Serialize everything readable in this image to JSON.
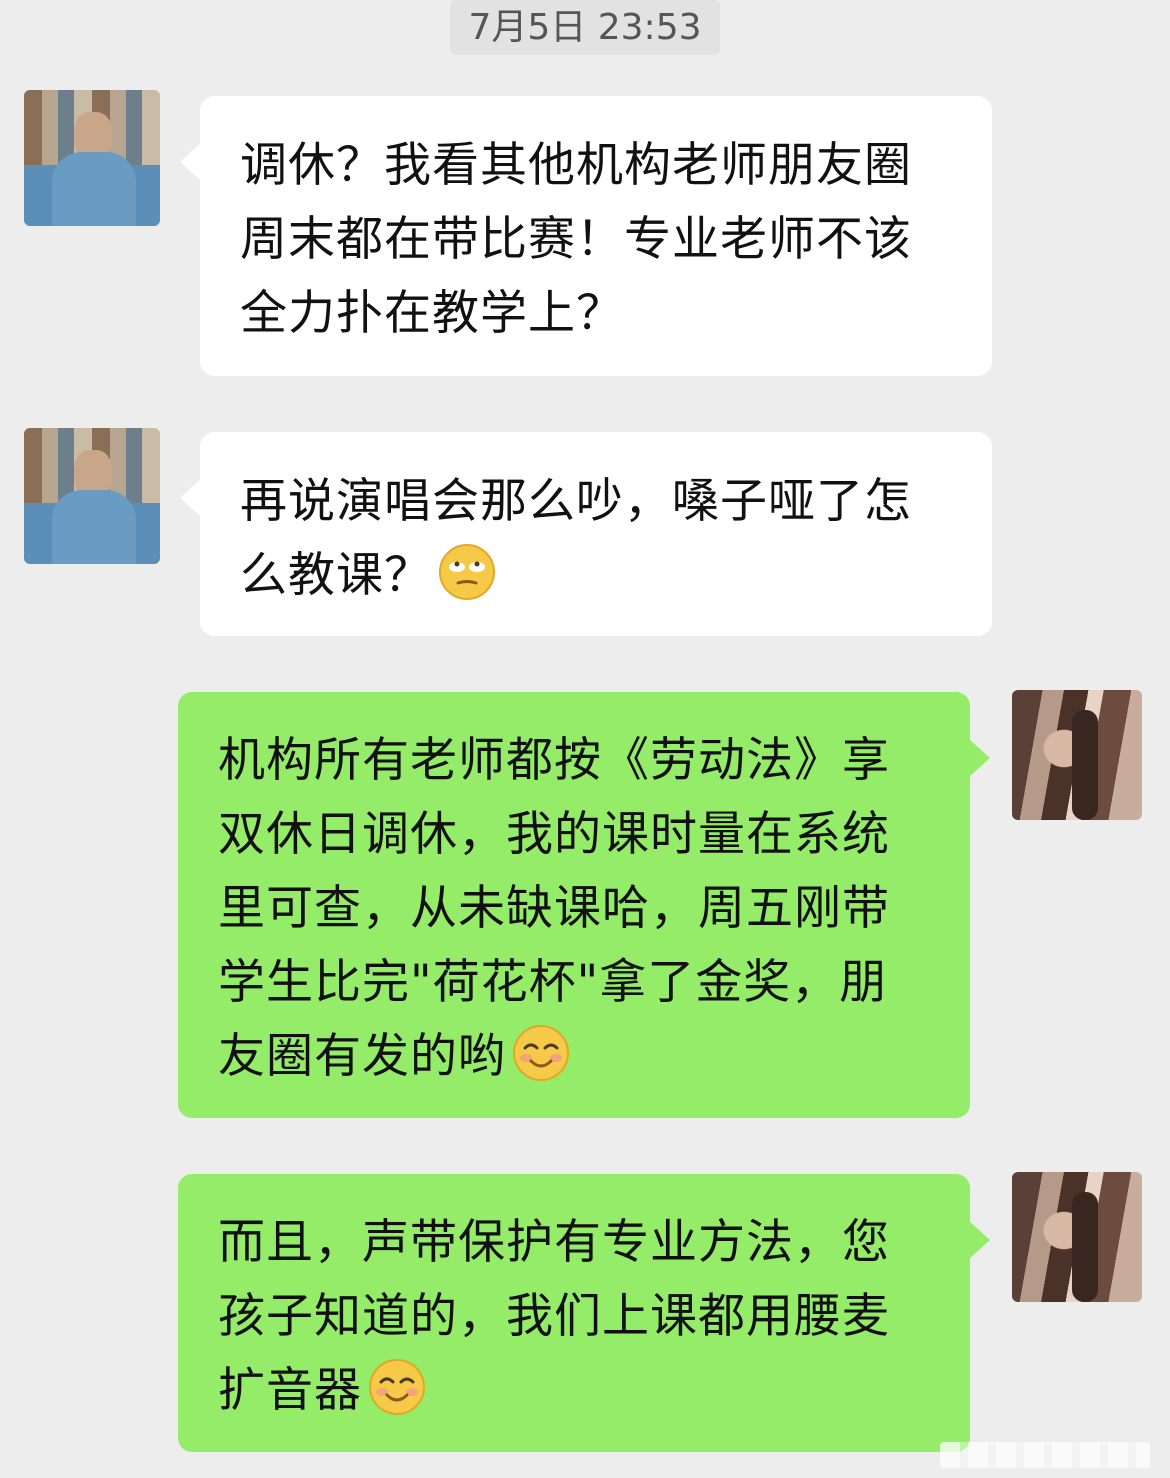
{
  "timestamp": "7月5日 23:53",
  "colors": {
    "background": "#ededed",
    "incoming_bubble": "#ffffff",
    "outgoing_bubble": "#95ec69"
  },
  "messages": [
    {
      "sender": "other",
      "avatar_icon": "pixelated-avatar",
      "lines": [
        "调休？我看其他机构老师朋友圈",
        "周末都在带比赛！专业老师不该",
        "全力扑在教学上？"
      ],
      "trailing_emoji": null
    },
    {
      "sender": "other",
      "avatar_icon": "pixelated-avatar",
      "lines": [
        "再说演唱会那么吵，嗓子哑了怎",
        "么教课？"
      ],
      "trailing_emoji": "eye-roll-emoji"
    },
    {
      "sender": "self",
      "avatar_icon": "profile-photo-avatar",
      "lines": [
        "机构所有老师都按《劳动法》享",
        "双休日调休，我的课时量在系统",
        "里可查，从未缺课哈，周五刚带",
        "学生比完\"荷花杯\"拿了金奖，朋",
        "友圈有发的哟"
      ],
      "trailing_emoji": "smile-emoji"
    },
    {
      "sender": "self",
      "avatar_icon": "profile-photo-avatar",
      "lines": [
        "而且，声带保护有专业方法，您",
        "孩子知道的，我们上课都用腰麦",
        "扩音器"
      ],
      "trailing_emoji": "smile-emoji"
    }
  ]
}
